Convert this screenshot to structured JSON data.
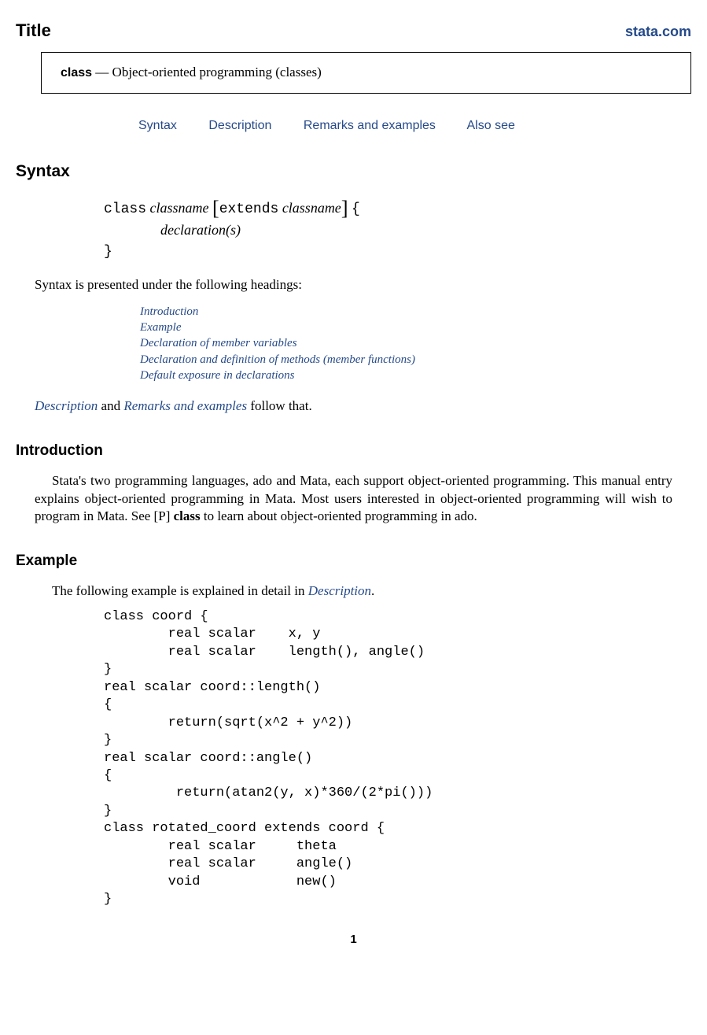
{
  "header": {
    "title": "Title",
    "site": "stata.com"
  },
  "title_box": {
    "name": "class",
    "dash": " — ",
    "desc": "Object-oriented programming (classes)"
  },
  "nav": {
    "items": [
      "Syntax",
      "Description",
      "Remarks and examples",
      "Also see"
    ]
  },
  "syntax": {
    "heading": "Syntax",
    "kw_class": "class",
    "classname": "classname",
    "kw_extends": "extends",
    "declarations": "declaration(s)",
    "intro_line": "Syntax is presented under the following headings:",
    "toc": [
      "Introduction",
      "Example",
      "Declaration of member variables",
      "Declaration and definition of methods (member functions)",
      "Default exposure in declarations"
    ],
    "follow_prefix": "Description",
    "follow_and": " and ",
    "follow_mid": "Remarks and examples",
    "follow_suffix": " follow that."
  },
  "intro": {
    "heading": "Introduction",
    "body_1": "Stata's two programming languages, ado and Mata, each support object-oriented programming. This manual entry explains object-oriented programming in Mata. Most users interested in object-oriented programming will wish to program in Mata. See ",
    "ref_bracket": "[P]",
    "ref_bold": " class",
    "body_2": " to learn about object-oriented programming in ado."
  },
  "example": {
    "heading": "Example",
    "lead": "The following example is explained in detail in ",
    "lead_em": "Description",
    "lead_end": ".",
    "code": "class coord {\n        real scalar    x, y\n        real scalar    length(), angle()\n}\nreal scalar coord::length()\n{\n        return(sqrt(x^2 + y^2))\n}\nreal scalar coord::angle()\n{\n         return(atan2(y, x)*360/(2*pi()))\n}\nclass rotated_coord extends coord {\n        real scalar     theta\n        real scalar     angle()\n        void            new()\n}"
  },
  "page_number": "1"
}
